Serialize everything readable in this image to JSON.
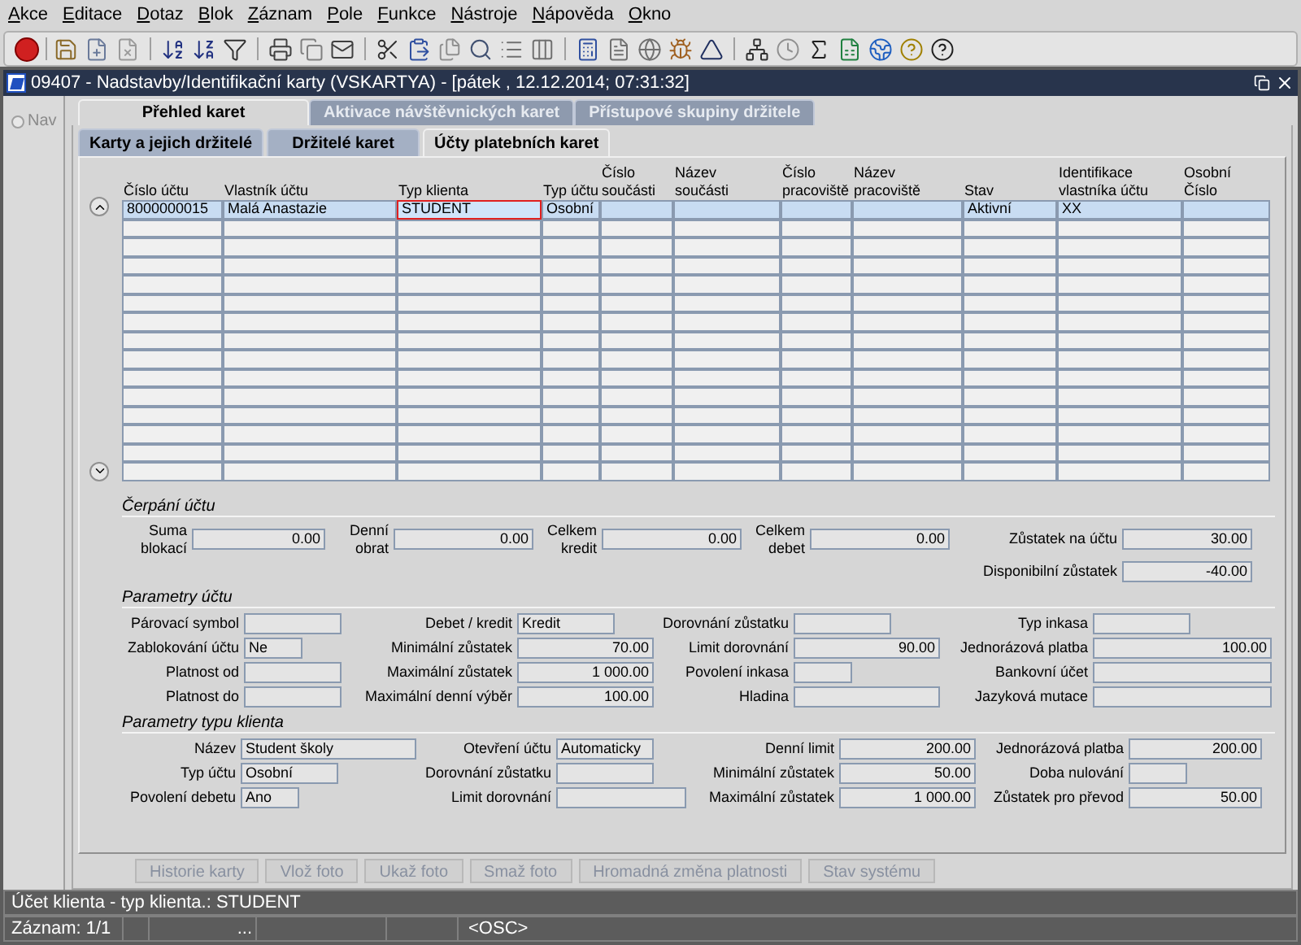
{
  "menu": [
    "Akce",
    "Editace",
    "Dotaz",
    "Blok",
    "Záznam",
    "Pole",
    "Funkce",
    "Nástroje",
    "Nápověda",
    "Okno"
  ],
  "window": {
    "title": "09407 - Nadstavby/Identifikační karty (VSKARTYA) - [pátek , 12.12.2014; 07:31:32]"
  },
  "nav": {
    "label": "Nav",
    "selected": false
  },
  "tabs": [
    {
      "label": "Přehled karet",
      "selected": true,
      "disabled": false
    },
    {
      "label": "Aktivace návštěvnických karet",
      "selected": false,
      "disabled": true
    },
    {
      "label": "Přístupové skupiny držitele",
      "selected": false,
      "disabled": true
    }
  ],
  "subtabs": [
    {
      "label": "Karty a jejich držitelé",
      "selected": false
    },
    {
      "label": "Držitelé karet",
      "selected": false
    },
    {
      "label": "Účty platebních karet",
      "selected": true
    }
  ],
  "table": {
    "columns": [
      [
        "Číslo účtu"
      ],
      [
        "Vlastník účtu"
      ],
      [
        "Typ klienta"
      ],
      [
        "Typ účtu"
      ],
      [
        "Číslo",
        "součásti"
      ],
      [
        "Název",
        "součásti"
      ],
      [
        "Číslo",
        "pracoviště"
      ],
      [
        "Název",
        "pracoviště"
      ],
      [
        "Stav"
      ],
      [
        "Identifikace",
        "vlastníka účtu"
      ],
      [
        "Osobní",
        "Číslo"
      ]
    ],
    "rows": [
      {
        "selected": true,
        "cells": [
          {
            "text": "8000000015",
            "focused": false
          },
          {
            "text": "Malá Anastazie",
            "focused": false
          },
          {
            "text": "STUDENT",
            "focused": true
          },
          {
            "text": "Osobní",
            "focused": false
          },
          null,
          null,
          null,
          null,
          {
            "text": "Aktivní",
            "focused": false
          },
          {
            "text": "XX",
            "focused": false
          },
          null
        ]
      },
      {
        "selected": false
      },
      {
        "selected": false
      },
      {
        "selected": false
      },
      {
        "selected": false
      },
      {
        "selected": false
      },
      {
        "selected": false
      },
      {
        "selected": false
      },
      {
        "selected": false
      },
      {
        "selected": false
      },
      {
        "selected": false
      },
      {
        "selected": false
      },
      {
        "selected": false
      },
      {
        "selected": false
      },
      {
        "selected": false
      }
    ]
  },
  "sections": [
    {
      "title": "Čerpání účtu",
      "rows": [
        [
          {
            "label": "Suma blokací",
            "kind": "number",
            "value": "0.00"
          },
          {
            "label": "Denní obrat",
            "kind": "number",
            "value": "0.00"
          },
          {
            "label": "Celkem kredit",
            "kind": "number",
            "value": "0.00"
          },
          {
            "label": "Celkem debet",
            "kind": "number",
            "value": "0.00"
          },
          {
            "label": "Zůstatek na účtu",
            "kind": "number",
            "value": "30.00"
          }
        ],
        [
          null,
          null,
          null,
          null,
          {
            "label": "Disponibilní zůstatek",
            "kind": "number",
            "value": "-40.00"
          }
        ]
      ]
    },
    {
      "title": "Parametry účtu",
      "rows": [
        [
          {
            "label": "Párovací symbol",
            "kind": "text"
          },
          {
            "label": "Debet / kredit",
            "kind": "text",
            "value": "Kredit"
          },
          {
            "label": "Dorovnání zůstatku",
            "kind": "text"
          },
          {
            "label": "Typ inkasa",
            "kind": "text"
          }
        ],
        [
          {
            "label": "Zablokování účtu",
            "kind": "short",
            "value": "Ne"
          },
          {
            "label": "Minimální zůstatek",
            "kind": "number",
            "value": "70.00"
          },
          {
            "label": "Limit dorovnání",
            "kind": "number",
            "value": "90.00"
          },
          {
            "label": "Jednorázová platba",
            "kind": "number",
            "value": "100.00"
          }
        ],
        [
          {
            "label": "Platnost od",
            "kind": "text"
          },
          {
            "label": "Maximální zůstatek",
            "kind": "number",
            "value": "1 000.00"
          },
          {
            "label": "Povolení inkasa",
            "kind": "short"
          },
          {
            "label": "Bankovní účet",
            "kind": "long"
          }
        ],
        [
          {
            "label": "Platnost do",
            "kind": "text"
          },
          {
            "label": "Maximální denní výběr",
            "kind": "number",
            "value": "100.00"
          },
          {
            "label": "Hladina",
            "kind": "long"
          },
          {
            "label": "Jazyková mutace",
            "kind": "long"
          }
        ]
      ]
    },
    {
      "title": "Parametry typu klienta",
      "rows": [
        [
          {
            "label": "Název",
            "kind": "long",
            "value": "Student školy"
          },
          {
            "label": "Otevření účtu",
            "kind": "text",
            "value": "Automaticky"
          },
          {
            "label": "Denní limit",
            "kind": "number",
            "value": "200.00"
          },
          {
            "label": "Jednorázová platba",
            "kind": "number",
            "value": "200.00"
          }
        ],
        [
          {
            "label": "Typ účtu",
            "kind": "text",
            "value": "Osobní"
          },
          {
            "label": "Dorovnání zůstatku",
            "kind": "text"
          },
          {
            "label": "Minimální zůstatek",
            "kind": "number",
            "value": "50.00"
          },
          {
            "label": "Doba nulování",
            "kind": "short"
          }
        ],
        [
          {
            "label": "Povolení debetu",
            "kind": "short",
            "value": "Ano"
          },
          {
            "label": "Limit dorovnání",
            "kind": "long"
          },
          {
            "label": "Maximální zůstatek",
            "kind": "number",
            "value": "1 000.00"
          },
          {
            "label": "Zůstatek pro převod",
            "kind": "number",
            "value": "50.00"
          }
        ]
      ]
    }
  ],
  "buttons": [
    {
      "label": "Historie karty",
      "disabled": true
    },
    {
      "label": "Vlož foto",
      "disabled": true
    },
    {
      "label": "Ukaž foto",
      "disabled": true
    },
    {
      "label": "Smaž foto",
      "disabled": true
    },
    {
      "label": "Hromadná změna platnosti",
      "disabled": true
    },
    {
      "label": "Stav systému",
      "disabled": true
    }
  ],
  "status_bar": {
    "message": "Účet klienta - typ klienta.: STUDENT",
    "record": "Záznam: 1/1",
    "segment_3": "...",
    "mode": "<OSC>"
  }
}
